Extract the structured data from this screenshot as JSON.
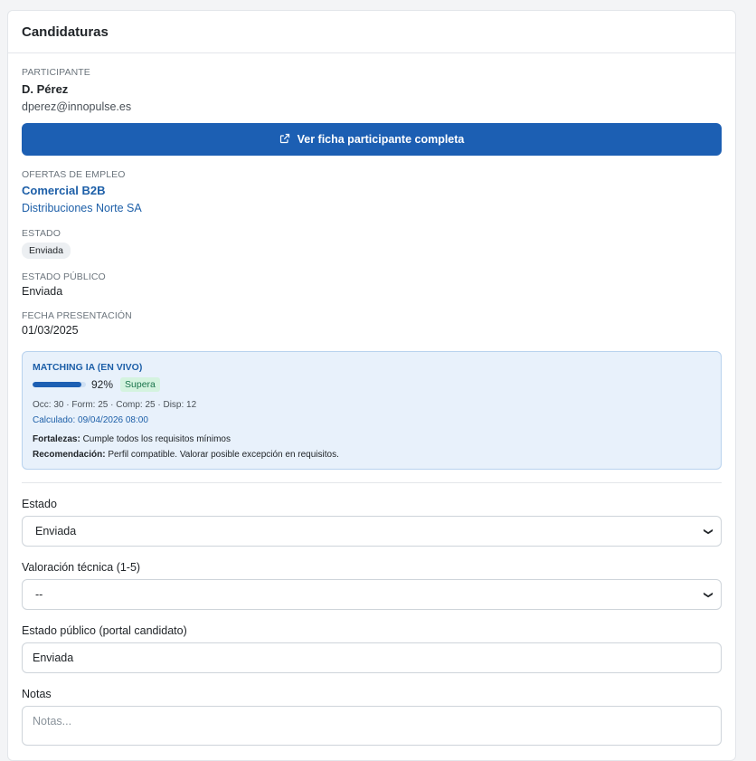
{
  "header": {
    "title": "Candidaturas"
  },
  "participant": {
    "label": "PARTICIPANTE",
    "name": "D. Pérez",
    "email": "dperez@innopulse.es",
    "button_label": "Ver ficha participante completa",
    "button_icon": "external-link-icon"
  },
  "offers": {
    "label": "OFERTAS DE EMPLEO",
    "title": "Comercial B2B",
    "company": "Distribuciones Norte SA"
  },
  "status": {
    "label": "ESTADO",
    "value": "Enviada"
  },
  "public_status": {
    "label": "ESTADO PÚBLICO",
    "value": "Enviada"
  },
  "date": {
    "label": "FECHA PRESENTACIÓN",
    "value": "01/03/2025"
  },
  "matching": {
    "title": "MATCHING IA (EN VIVO)",
    "score": 0.92,
    "score_text": "92%",
    "result_badge": "Supera",
    "breakdown": "Occ: 30 · Form: 25 · Comp: 25 · Disp: 12",
    "calculated": "Calculado: 09/04/2026 08:00",
    "strengths_label": "Fortalezas:",
    "strengths": "Cumple todos los requisitos mínimos",
    "recommendation_label": "Recomendación:",
    "recommendation": "Perfil compatible. Valorar posible excepción en requisitos."
  },
  "form": {
    "estado_label": "Estado",
    "estado_value": "Enviada",
    "valoracion_label": "Valoración técnica (1-5)",
    "valoracion_value": "--",
    "publico_label": "Estado público (portal candidato)",
    "publico_value": "Enviada",
    "notas_label": "Notas",
    "notas_placeholder": "Notas..."
  },
  "colors": {
    "primary": "#1c5fb3",
    "link": "#1d5fa8",
    "success_bg": "#d4f3df",
    "success_text": "#19734a"
  }
}
